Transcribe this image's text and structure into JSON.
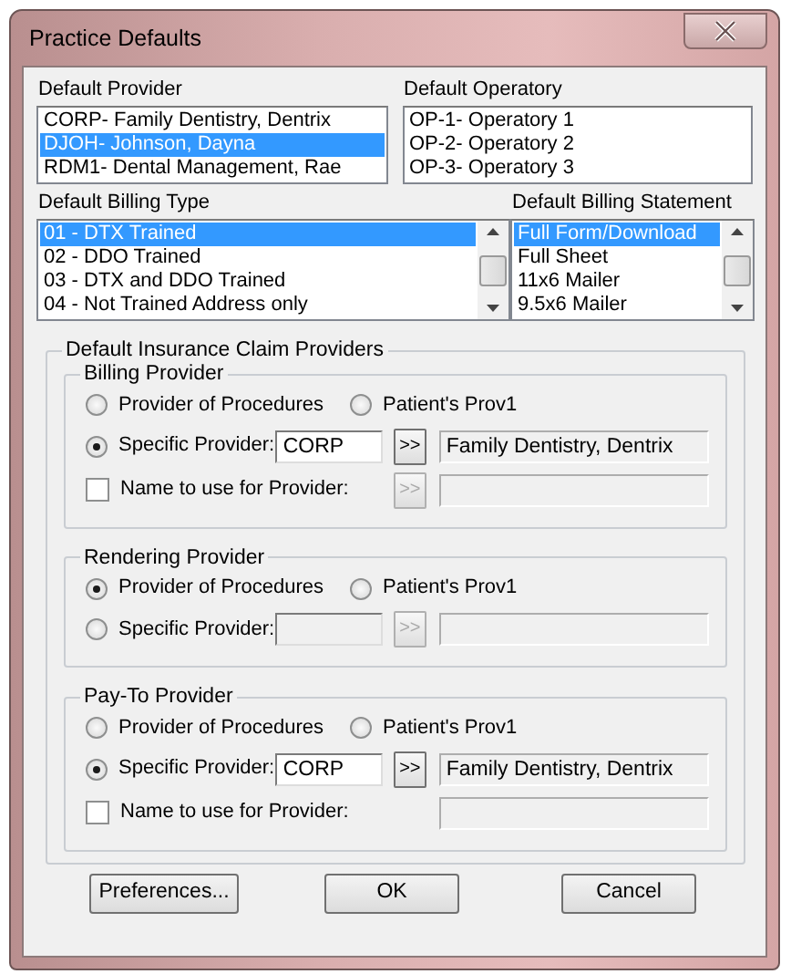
{
  "window": {
    "title": "Practice Defaults"
  },
  "top_lists": [
    {
      "label": "Default Provider",
      "scrollbar": false,
      "items": [
        {
          "text": "CORP- Family Dentistry, Dentrix",
          "selected": false
        },
        {
          "text": "DJOH- Johnson, Dayna",
          "selected": true
        },
        {
          "text": "RDM1- Dental Management, Rae",
          "selected": false
        }
      ]
    },
    {
      "label": "Default Operatory",
      "scrollbar": false,
      "items": [
        {
          "text": "OP-1- Operatory 1",
          "selected": false
        },
        {
          "text": "OP-2- Operatory 2",
          "selected": false
        },
        {
          "text": "OP-3- Operatory 3",
          "selected": false
        }
      ]
    }
  ],
  "billing_lists": [
    {
      "label": "Default Billing Type",
      "scrollbar": true,
      "items": [
        {
          "text": "01 - DTX Trained",
          "selected": true
        },
        {
          "text": "02 - DDO Trained",
          "selected": false
        },
        {
          "text": "03 - DTX and DDO Trained",
          "selected": false
        },
        {
          "text": "04 - Not Trained Address only",
          "selected": false
        }
      ]
    },
    {
      "label": "Default Billing Statement",
      "scrollbar": true,
      "items": [
        {
          "text": "Full Form/Download",
          "selected": true
        },
        {
          "text": "Full Sheet",
          "selected": false
        },
        {
          "text": "11x6 Mailer",
          "selected": false
        },
        {
          "text": "9.5x6 Mailer",
          "selected": false
        }
      ]
    }
  ],
  "insurance": {
    "title": "Default Insurance Claim Providers",
    "sections": [
      {
        "title": "Billing Provider",
        "options": [
          {
            "label": "Provider of Procedures",
            "selected": false
          },
          {
            "label": "Patient's Prov1",
            "selected": false
          }
        ],
        "specific": {
          "label": "Specific Provider:",
          "selected": true,
          "code": "CORP",
          "button": ">>",
          "button_disabled": false,
          "name": "Family Dentistry, Dentrix",
          "code_disabled": false
        },
        "name_row": {
          "label": "Name to use for Provider:",
          "checked": false,
          "button": ">>"
        }
      },
      {
        "title": "Rendering Provider",
        "options": [
          {
            "label": "Provider of Procedures",
            "selected": true
          },
          {
            "label": "Patient's Prov1",
            "selected": false
          }
        ],
        "specific": {
          "label": "Specific Provider:",
          "selected": false,
          "button": ">>",
          "button_disabled": true,
          "code_disabled": true
        }
      },
      {
        "title": "Pay-To Provider",
        "options": [
          {
            "label": "Provider of Procedures",
            "selected": false
          },
          {
            "label": "Patient's Prov1",
            "selected": false
          }
        ],
        "specific": {
          "label": "Specific Provider:",
          "selected": true,
          "code": "CORP",
          "button": ">>",
          "button_disabled": false,
          "name": "Family Dentistry, Dentrix",
          "code_disabled": false
        },
        "name_row": {
          "label": "Name to use for Provider:",
          "checked": false
        }
      }
    ]
  },
  "buttons": [
    "Preferences...",
    "OK",
    "Cancel"
  ]
}
